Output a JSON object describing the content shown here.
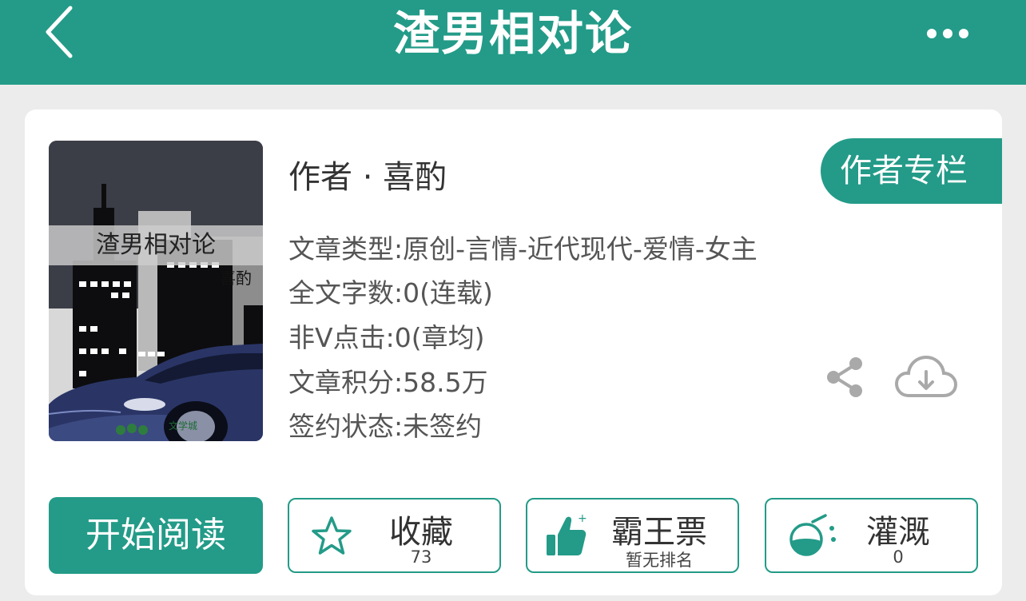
{
  "header": {
    "title": "渣男相对论",
    "back_icon": "back-chevron-icon",
    "more_icon": "more-dots-icon"
  },
  "book": {
    "cover": {
      "title_text": "渣男相对论",
      "author_text": "喜酌",
      "watermark": "文学城"
    },
    "author_line": "作者 · 喜酌",
    "author_column_label": "作者专栏",
    "info": {
      "type": "文章类型:原创-言情-近代现代-爱情-女主",
      "word_count": "全文字数:0(连载)",
      "non_v_clicks": "非Ⅴ点击:0(章均)",
      "score": "文章积分:58.5万",
      "sign_status": "签约状态:未签约"
    }
  },
  "actions": {
    "read_label": "开始阅读",
    "favorite": {
      "label": "收藏",
      "sub": "73",
      "icon": "star-icon"
    },
    "ticket": {
      "label": "霸王票",
      "sub": "暂无排名",
      "icon": "thumbs-up-icon"
    },
    "water": {
      "label": "灌溉",
      "sub": "0",
      "icon": "flask-icon"
    },
    "share_icon": "share-icon",
    "download_icon": "cloud-download-icon"
  },
  "colors": {
    "accent": "#239b88",
    "background": "#ececec"
  }
}
